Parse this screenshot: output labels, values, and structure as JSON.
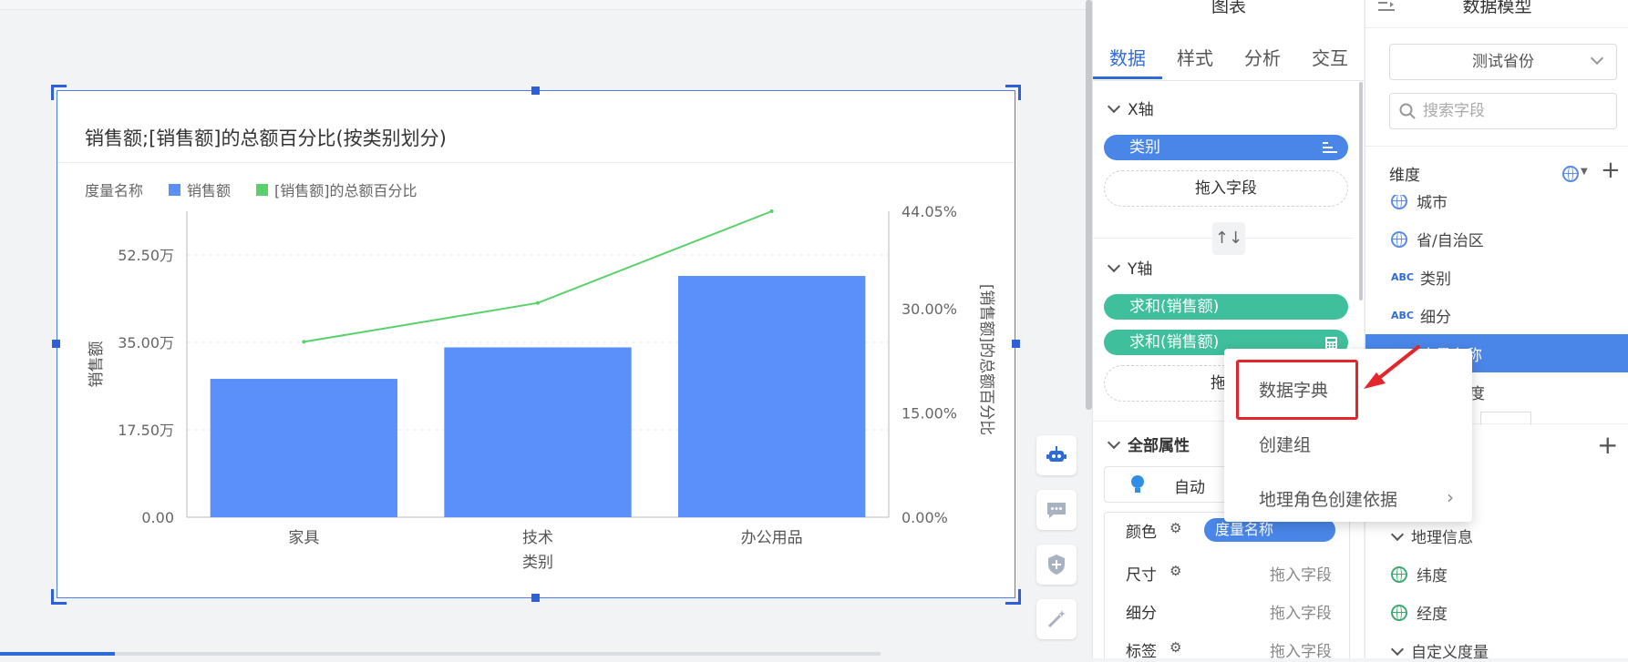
{
  "canvas": {
    "chart": {
      "title": "销售额;[销售额]的总额百分比(按类别划分)",
      "legend": {
        "label": "度量名称",
        "items": [
          {
            "name": "销售额",
            "color": "#5b8ff9"
          },
          {
            "name": "[销售额]的总额百分比",
            "color": "#5ad06a"
          }
        ]
      }
    },
    "tools": [
      "robot-icon",
      "comment-icon",
      "shield-icon",
      "magic-wand-icon"
    ]
  },
  "chart_data": {
    "type": "bar",
    "categories": [
      "家具",
      "技术",
      "办公用品"
    ],
    "series": [
      {
        "name": "销售额",
        "type": "bar",
        "axis": "left",
        "values": [
          277000,
          340000,
          483000
        ],
        "color": "#5b8ff9"
      },
      {
        "name": "[销售额]的总额百分比",
        "type": "line",
        "axis": "right",
        "values": [
          0.2525,
          0.3085,
          0.4405
        ],
        "color": "#5ad06a"
      }
    ],
    "xlabel": "类别",
    "ylabel": "销售额",
    "y2label": "[销售额]的总额百分比",
    "yticks": [
      "0.00",
      "17.50万",
      "35.00万",
      "52.50万"
    ],
    "ylim": [
      0,
      612500
    ],
    "y2ticks": [
      "0.00%",
      "15.00%",
      "30.00%",
      "44.05%"
    ],
    "y2lim": [
      0,
      0.4405
    ],
    "grid": true,
    "legend_position": "top-left"
  },
  "prop_panel": {
    "header": "图表",
    "tabs": [
      "数据",
      "样式",
      "分析",
      "交互"
    ],
    "x_axis": {
      "label": "X轴",
      "field": "类别",
      "drop": "拖入字段"
    },
    "swap_label": "↑↓",
    "y_axis": {
      "label": "Y轴",
      "fields": [
        "求和(销售额)",
        "求和(销售额)"
      ],
      "drop": "拖入"
    },
    "all_props": {
      "label": "全部属性",
      "mark_type": "自动",
      "rows": [
        {
          "label": "颜色",
          "value": "度量名称"
        },
        {
          "label": "尺寸",
          "value": "拖入字段"
        },
        {
          "label": "细分",
          "value": "拖入字段"
        },
        {
          "label": "标签",
          "value": "拖入字段"
        }
      ]
    }
  },
  "model_panel": {
    "header": "数据模型",
    "dataset": "测试省份",
    "search_placeholder": "搜索字段",
    "dimension_label": "维度",
    "dimensions": [
      {
        "name": "城市",
        "type": "geo"
      },
      {
        "name": "省/自治区",
        "type": "geo"
      },
      {
        "name": "类别",
        "type": "abc"
      },
      {
        "name": "细分",
        "type": "abc"
      },
      {
        "name": "度量名称",
        "type": "abc"
      }
    ],
    "hidden_partial": "度",
    "geo_section": "地理信息",
    "geo_fields": [
      "纬度",
      "经度"
    ],
    "custom_measure": "自定义度量"
  },
  "context_menu": {
    "items": [
      "数据字典",
      "创建组",
      "地理角色创建依据"
    ]
  }
}
